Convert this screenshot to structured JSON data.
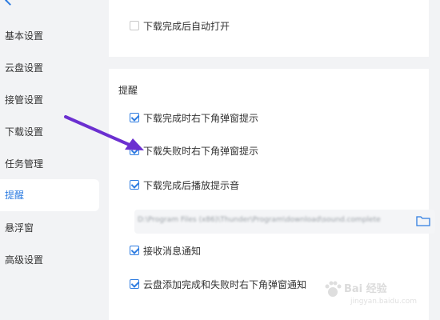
{
  "sidebar": {
    "items": [
      {
        "label": "基本设置",
        "active": false
      },
      {
        "label": "云盘设置",
        "active": false
      },
      {
        "label": "接管设置",
        "active": false
      },
      {
        "label": "下载设置",
        "active": false
      },
      {
        "label": "任务管理",
        "active": false
      },
      {
        "label": "提醒",
        "active": true
      },
      {
        "label": "悬浮窗",
        "active": false
      },
      {
        "label": "高级设置",
        "active": false
      }
    ]
  },
  "top_card": {
    "auto_open_label": "下载完成后自动打开",
    "auto_open_checked": false
  },
  "reminder": {
    "title": "提醒",
    "options": [
      {
        "label": "下载完成时右下角弹窗提示",
        "checked": true
      },
      {
        "label": "下载失败时右下角弹窗提示",
        "checked": true
      },
      {
        "label": "下载完成后播放提示音",
        "checked": true
      },
      {
        "label": "接收消息通知",
        "checked": true
      },
      {
        "label": "云盘添加完成和失败时右下角弹窗通知",
        "checked": true
      }
    ],
    "sound_path": "D:\\Program Files (x86)\\Thunder\\Program\\download\\sound.complete"
  },
  "annotation": {
    "arrow_color": "#6b2fd0"
  },
  "watermark": {
    "main": "Bai 经验",
    "sub": "jingyan.baidu.com"
  },
  "colors": {
    "accent": "#2f7de1",
    "background": "#f2f3f5"
  },
  "icons": {
    "folder": "folder-icon",
    "back": "chevron-left-icon"
  }
}
